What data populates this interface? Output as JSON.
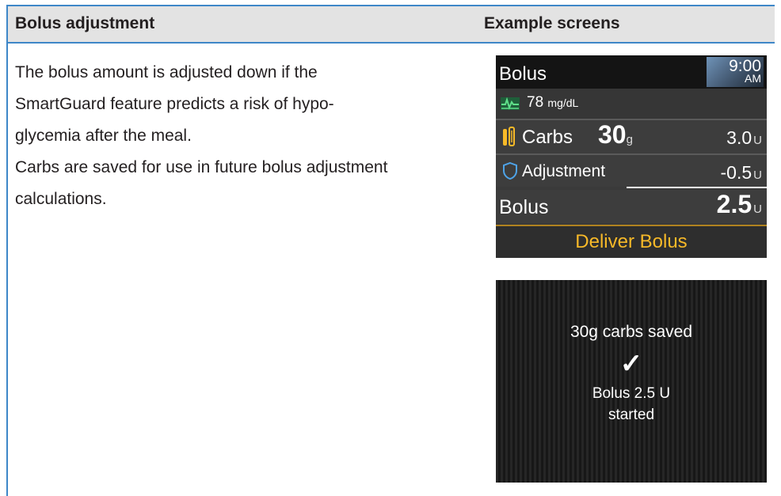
{
  "table": {
    "headers": {
      "left": "Bolus adjustment",
      "right": "Example screens"
    },
    "body_lines": [
      "The bolus amount is adjusted down if the",
      "SmartGuard feature predicts a risk of hypo-",
      "glycemia after the meal.",
      "Carbs are saved for use in future bolus adjustment",
      "calculations."
    ]
  },
  "screen1": {
    "title": "Bolus",
    "time": "9:00",
    "ampm": "AM",
    "sg_value": "78",
    "sg_unit": "mg/dL",
    "carbs_label": "Carbs",
    "carbs_value": "30",
    "carbs_unit": "g",
    "carbs_insulin": "3.0",
    "insulin_unit": "U",
    "adjustment_label": "Adjustment",
    "adjustment_value": "-0.5",
    "bolus_label": "Bolus",
    "bolus_value": "2.5",
    "deliver_label": "Deliver Bolus",
    "icons": [
      "sensor-glucose-icon",
      "carbs-icon",
      "shield-icon"
    ],
    "accent_color": "#f7b928"
  },
  "screen2": {
    "saved_message": "30g carbs saved",
    "check_glyph": "✓",
    "bolus_message": "Bolus 2.5 U",
    "started_message": "started"
  },
  "colors": {
    "rule_blue": "#3e87c8",
    "header_gray": "#e3e3e3"
  }
}
